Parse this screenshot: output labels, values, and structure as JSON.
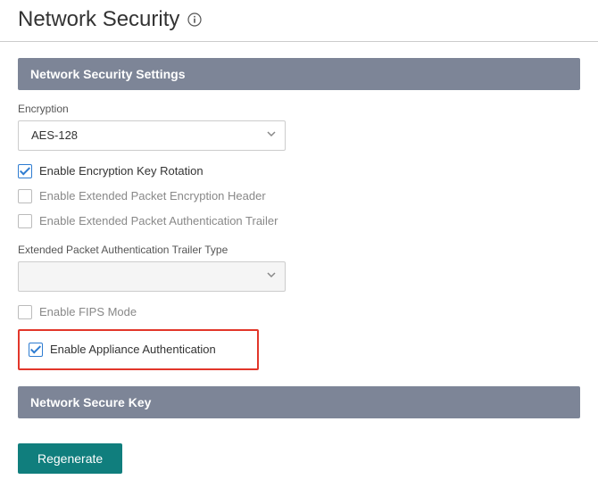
{
  "header": {
    "title": "Network Security",
    "info_icon": "info-icon"
  },
  "sections": {
    "settings": {
      "title": "Network Security Settings",
      "encryption": {
        "label": "Encryption",
        "selected": "AES-128"
      },
      "checkboxes": {
        "rotation": {
          "label": "Enable Encryption Key Rotation",
          "checked": true
        },
        "ext_header": {
          "label": "Enable Extended Packet Encryption Header",
          "checked": false
        },
        "ext_trailer": {
          "label": "Enable Extended Packet Authentication Trailer",
          "checked": false
        },
        "fips": {
          "label": "Enable FIPS Mode",
          "checked": false
        },
        "appliance_auth": {
          "label": "Enable Appliance Authentication",
          "checked": true
        }
      },
      "trailer_type": {
        "label": "Extended Packet Authentication Trailer Type",
        "selected": ""
      }
    },
    "secure_key": {
      "title": "Network Secure Key",
      "regenerate_label": "Regenerate"
    }
  }
}
